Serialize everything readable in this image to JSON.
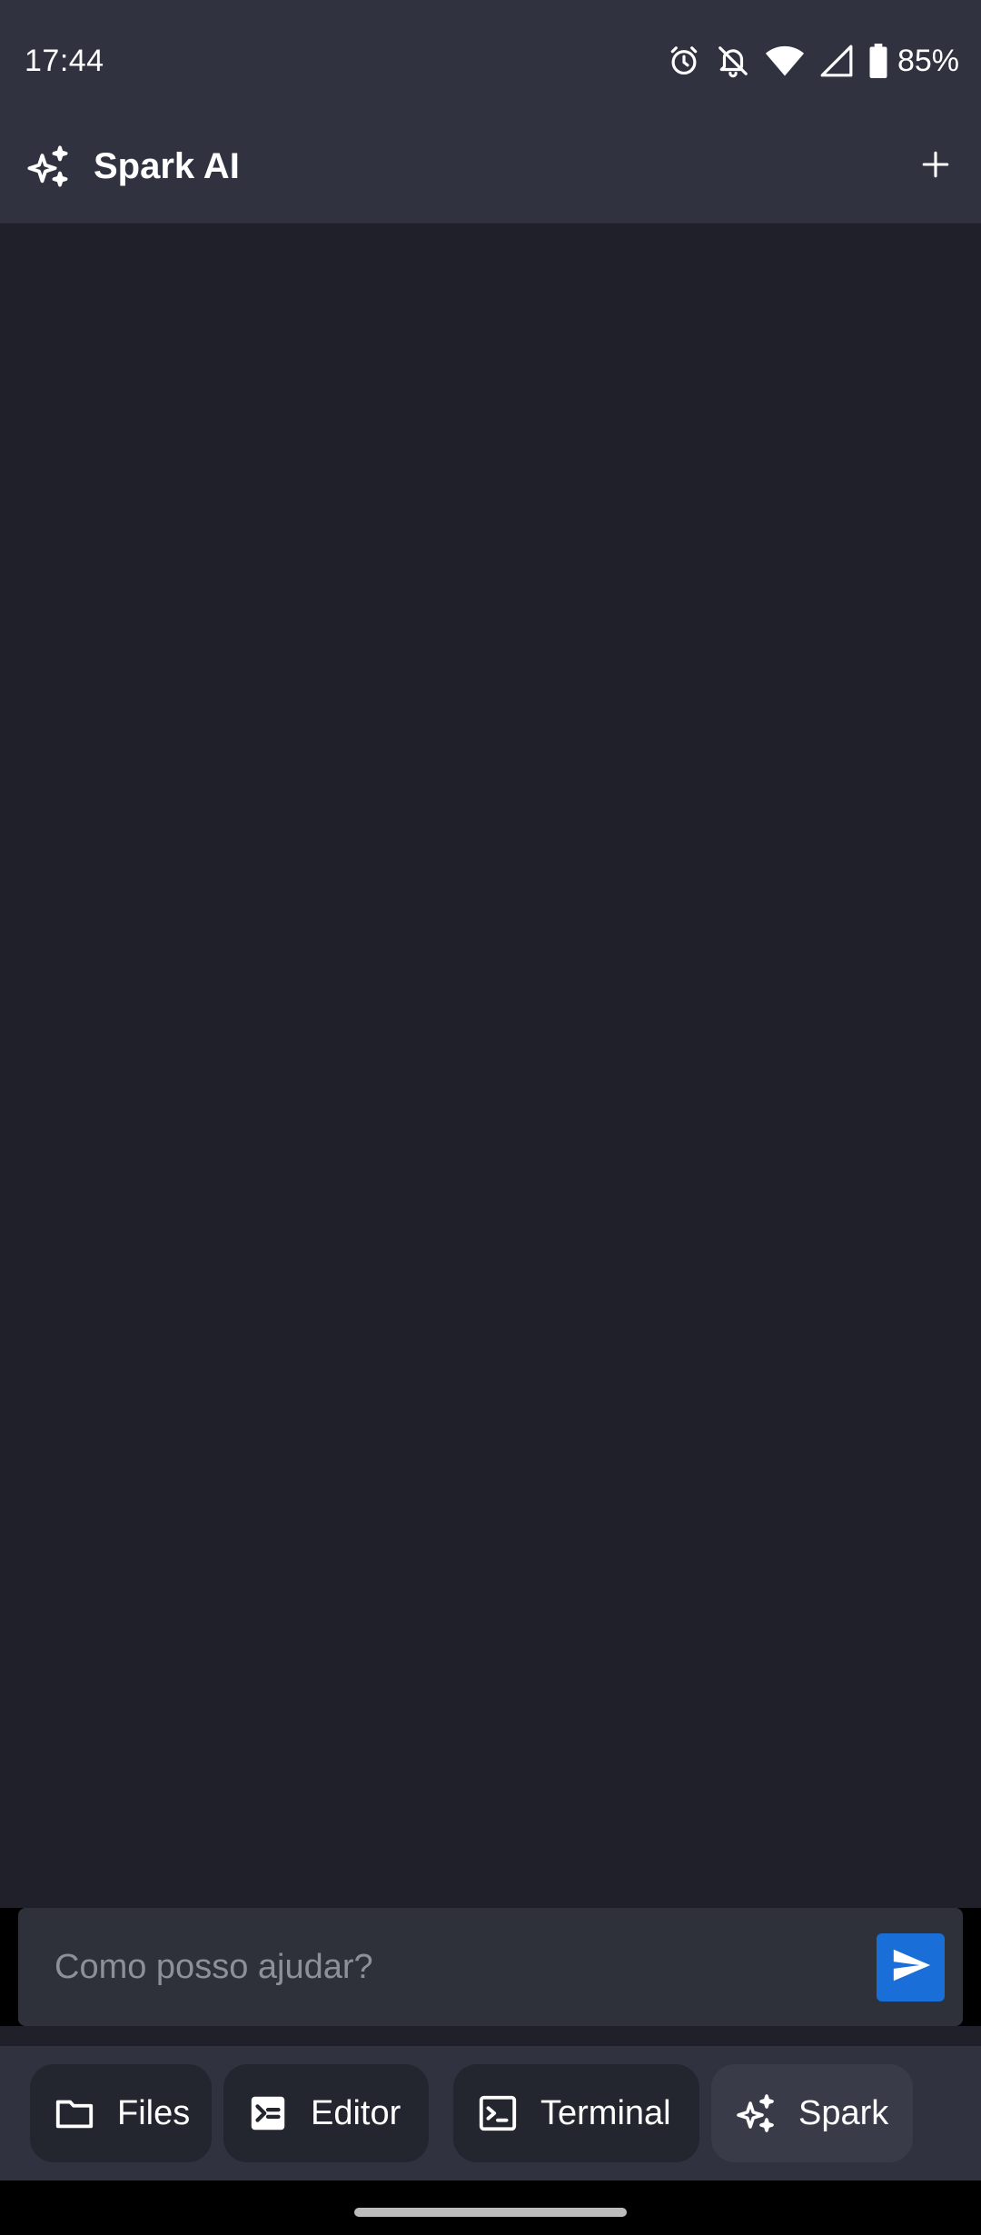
{
  "status_bar": {
    "time": "17:44",
    "battery_percent": "85%",
    "icons": [
      "alarm-icon",
      "notifications-off-icon",
      "wifi-icon",
      "cellular-signal-icon",
      "battery-icon"
    ]
  },
  "app_bar": {
    "title": "Spark AI",
    "logo_icon": "sparkle-icon",
    "new_chat_icon": "plus-icon"
  },
  "chat": {
    "input_placeholder": "Como posso ajudar?",
    "input_value": "",
    "send_icon": "send-icon"
  },
  "bottom_nav": {
    "items": [
      {
        "label": "Files",
        "icon": "folder-icon",
        "active": false
      },
      {
        "label": "Editor",
        "icon": "editor-icon",
        "active": false
      },
      {
        "label": "Terminal",
        "icon": "terminal-icon",
        "active": false
      },
      {
        "label": "Spark",
        "icon": "sparkle-icon",
        "active": true
      }
    ]
  },
  "colors": {
    "bar_background": "#30333f",
    "chat_background": "#1f2029",
    "accent": "#1a6ed8"
  }
}
